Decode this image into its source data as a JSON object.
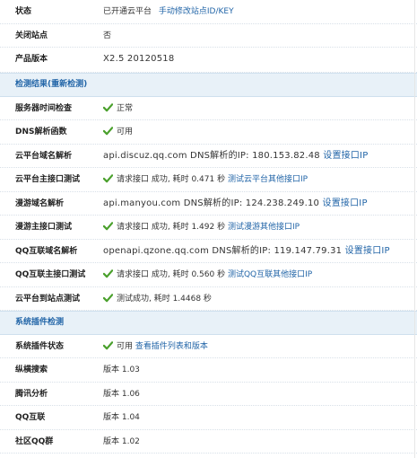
{
  "colors": {
    "accent": "#2366a8",
    "section_bg": "#e8f1f8",
    "check": "#4aa02c"
  },
  "rows_top": [
    {
      "label": "状态",
      "value": "已开通云平台",
      "link": "手动修改站点ID/KEY"
    },
    {
      "label": "关闭站点",
      "value": "否"
    },
    {
      "label": "产品版本",
      "value": "X2.5 20120518"
    }
  ],
  "section1": {
    "title": "检测结果(重新检测)"
  },
  "check_rows": [
    {
      "label": "服务器时间检查",
      "icon": "check-icon",
      "value": "正常"
    },
    {
      "label": "DNS解析函数",
      "icon": "check-icon",
      "value": "可用"
    },
    {
      "label": "云平台域名解析",
      "value": "api.discuz.qq.com DNS解析的IP: 180.153.82.48",
      "link": "设置接口IP"
    },
    {
      "label": "云平台主接口测试",
      "icon": "check-icon",
      "value": "请求接口 成功, 耗时 0.471 秒",
      "link": "测试云平台其他接口IP"
    },
    {
      "label": "漫游域名解析",
      "value": "api.manyou.com DNS解析的IP: 124.238.249.10",
      "link": "设置接口IP"
    },
    {
      "label": "漫游主接口测试",
      "icon": "check-icon",
      "value": "请求接口 成功, 耗时 1.492 秒",
      "link": "测试漫游其他接口IP"
    },
    {
      "label": "QQ互联域名解析",
      "value": "openapi.qzone.qq.com DNS解析的IP: 119.147.79.31",
      "link": "设置接口IP"
    },
    {
      "label": "QQ互联主接口测试",
      "icon": "check-icon",
      "value": "请求接口 成功, 耗时 0.560 秒",
      "link": "测试QQ互联其他接口IP"
    },
    {
      "label": "云平台到站点测试",
      "icon": "check-icon",
      "value": "测试成功, 耗时 1.4468 秒"
    }
  ],
  "section2": {
    "title": "系统插件检测"
  },
  "plugin_rows": [
    {
      "label": "系统插件状态",
      "icon": "check-icon",
      "value": "可用",
      "link": "查看插件列表和版本"
    },
    {
      "label": "纵横搜索",
      "value": "版本 1.03"
    },
    {
      "label": "腾讯分析",
      "value": "版本 1.06"
    },
    {
      "label": "QQ互联",
      "value": "版本 1.04"
    },
    {
      "label": "社区QQ群",
      "value": "版本 1.02"
    }
  ]
}
